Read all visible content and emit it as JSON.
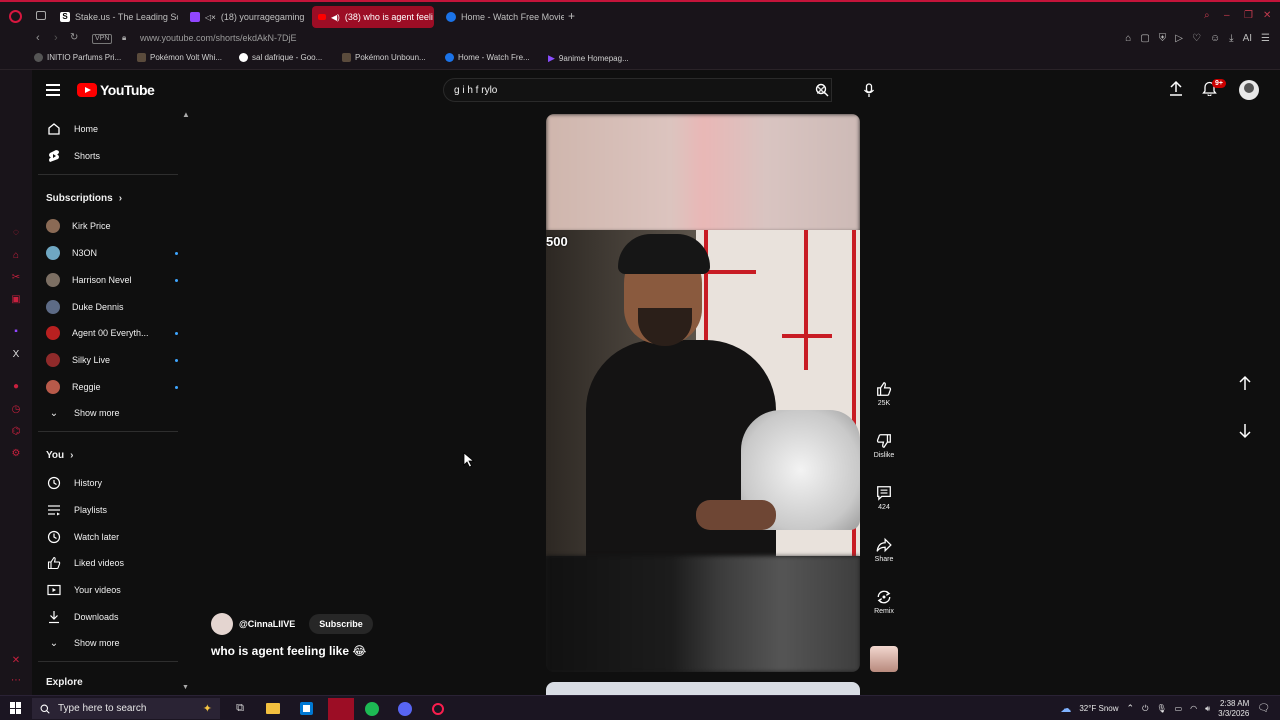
{
  "browser": {
    "tabs": [
      {
        "label": "Stake.us - The Leading Sc",
        "active": false
      },
      {
        "label": "(18) yourragegaming -",
        "active": false
      },
      {
        "label": "(38) who is agent feeli",
        "active": true
      },
      {
        "label": "Home - Watch Free Movie",
        "active": false
      }
    ],
    "new_tab": "+",
    "vpn_label": "VPN",
    "url": "www.youtube.com/shorts/ekdAkN-7DjE",
    "bookmarks": [
      "INITIO Parfums Pri...",
      "Pokémon Volt Whi...",
      "sal dafrique - Goo...",
      "Pokémon Unboun...",
      "Home - Watch Fre...",
      "9anime Homepag..."
    ],
    "ai_label": "AI",
    "colors": {
      "accent": "#c4143a",
      "chrome_bg": "#19141a"
    }
  },
  "youtube": {
    "logo_text": "YouTube",
    "search_value": "g i h f rylo",
    "notification_count": "9+",
    "sidebar": {
      "home": "Home",
      "shorts": "Shorts",
      "subscriptions_title": "Subscriptions",
      "subscriptions": [
        {
          "name": "Kirk Price",
          "live": false,
          "color": "#8a6a55"
        },
        {
          "name": "N3ON",
          "live": true,
          "color": "#6fa7c2"
        },
        {
          "name": "Harrison Nevel",
          "live": true,
          "color": "#7c6f63"
        },
        {
          "name": "Duke Dennis",
          "live": false,
          "color": "#5d6b86"
        },
        {
          "name": "Agent 00 Everyth...",
          "live": true,
          "color": "#b82020"
        },
        {
          "name": "Silky Live",
          "live": true,
          "color": "#8f2a2a"
        },
        {
          "name": "Reggie",
          "live": true,
          "color": "#b85a4a"
        }
      ],
      "show_more_1": "Show more",
      "you_title": "You",
      "you_items": [
        "History",
        "Playlists",
        "Watch later",
        "Liked videos",
        "Your videos",
        "Downloads"
      ],
      "show_more_2": "Show more",
      "explore_title": "Explore"
    },
    "short": {
      "overlay_number": "500",
      "channel_handle": "@CinnaLIIVE",
      "subscribe_label": "Subscribe",
      "title": "who is agent feeling like 😂",
      "likes": "25K",
      "dislike_label": "Dislike",
      "comments": "424",
      "share_label": "Share",
      "remix_label": "Remix"
    }
  },
  "taskbar": {
    "search_placeholder": "Type here to search",
    "weather": "32°F  Snow",
    "time": "2:38 AM",
    "date": "3/3/2026"
  }
}
